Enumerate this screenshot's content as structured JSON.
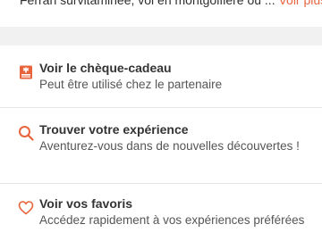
{
  "description": {
    "text": "Ferran survitaminée, voi en montgolfière ou ...",
    "more_label": "Voir plus"
  },
  "actions": [
    {
      "title": "Voir le chèque-cadeau",
      "subtitle": "Peut être utilisé chez le partenaire",
      "icon": "gift-card-icon"
    },
    {
      "title": "Trouver votre expérience",
      "subtitle": "Aventurez-vous dans de nouvelles découvertes !",
      "icon": "search-icon"
    },
    {
      "title": "Voir vos favoris",
      "subtitle": "Accédez rapidement à vos expériences préférées",
      "icon": "heart-icon"
    }
  ],
  "colors": {
    "accent": "#e8643c",
    "separator": "#f1f1f1",
    "divider": "#e6e6e6",
    "text": "#333333",
    "subtext": "#555555"
  }
}
